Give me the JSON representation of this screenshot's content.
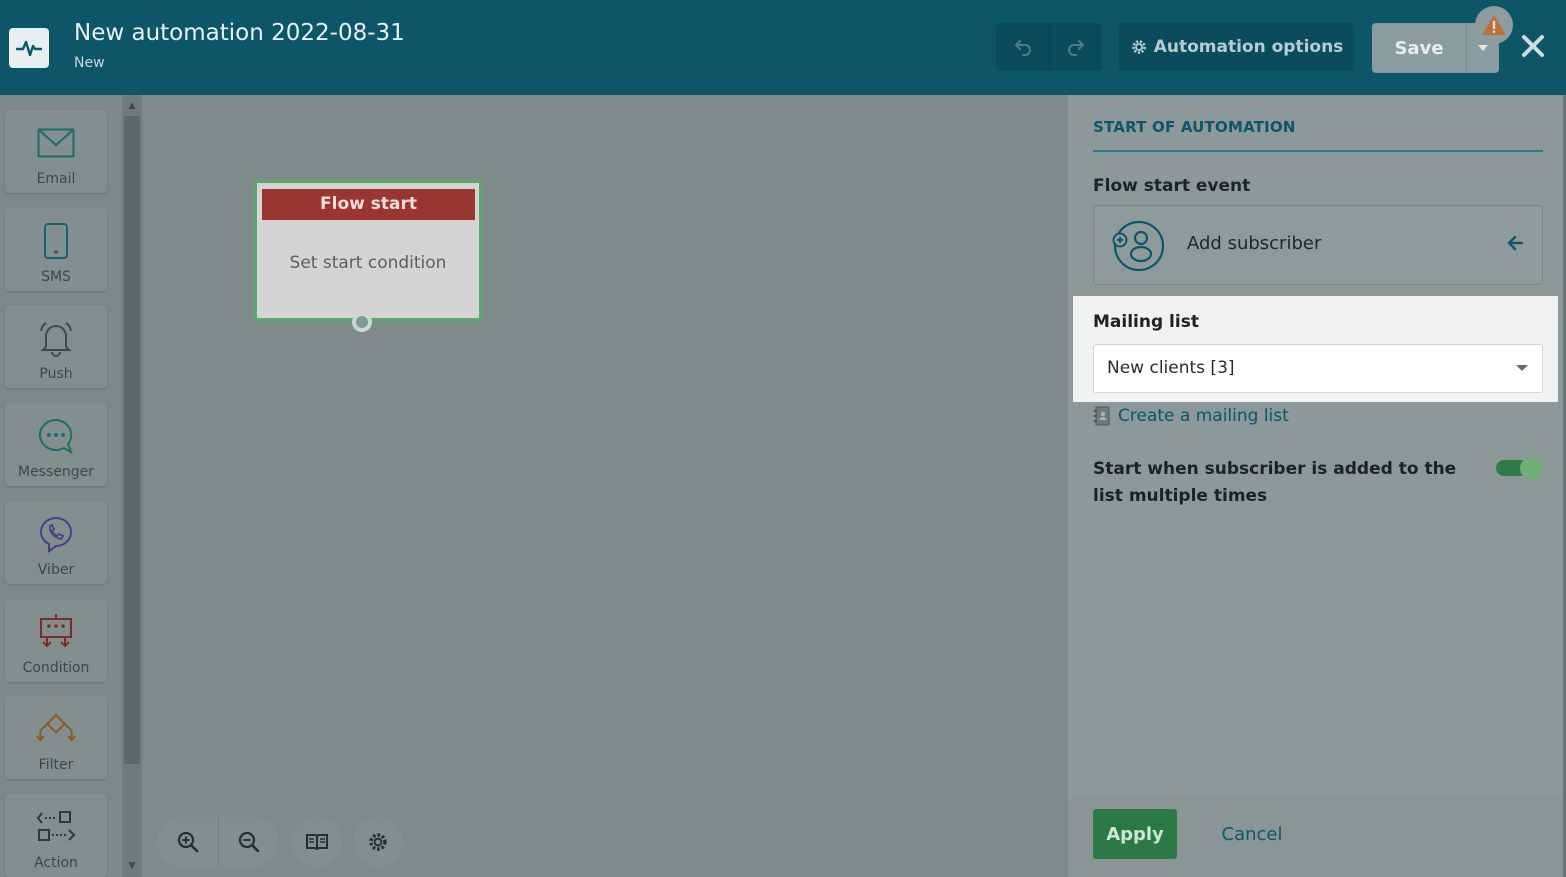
{
  "header": {
    "title": "New automation 2022-08-31",
    "status": "New",
    "automation_options_label": "Automation options",
    "save_label": "Save"
  },
  "tools": [
    {
      "label": "Email",
      "icon": "envelope-icon"
    },
    {
      "label": "SMS",
      "icon": "phone-icon"
    },
    {
      "label": "Push",
      "icon": "bell-icon"
    },
    {
      "label": "Messenger",
      "icon": "chat-icon"
    },
    {
      "label": "Viber",
      "icon": "viber-icon"
    },
    {
      "label": "Condition",
      "icon": "condition-icon"
    },
    {
      "label": "Filter",
      "icon": "filter-icon"
    },
    {
      "label": "Action",
      "icon": "action-icon"
    }
  ],
  "canvas": {
    "node_title": "Flow start",
    "node_body": "Set start condition"
  },
  "panel": {
    "heading": "START OF AUTOMATION",
    "event_label": "Flow start event",
    "event_value": "Add subscriber",
    "mailing_list_label": "Mailing list",
    "mailing_list_value": "New clients [3]",
    "create_link": "Create a mailing list",
    "toggle_label": "Start when subscriber is added to the list multiple times",
    "toggle_on": true,
    "apply_label": "Apply",
    "cancel_label": "Cancel"
  },
  "colors": {
    "header_bg": "#0c5668",
    "accent": "#0b5668",
    "apply_green": "#2b7a46",
    "flow_head_red": "#9b3530"
  }
}
